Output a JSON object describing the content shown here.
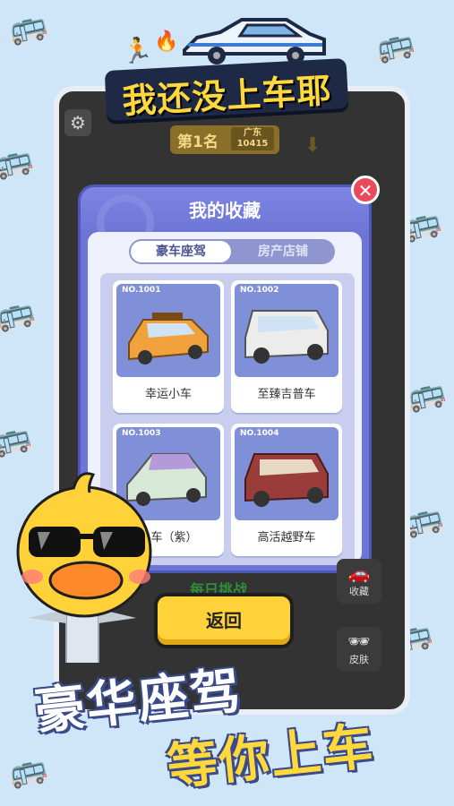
{
  "game": {
    "title": "我还没上车耶"
  },
  "hud": {
    "rank_label": "第1名",
    "rank_region": "广东",
    "rank_score": "10415"
  },
  "modal": {
    "title": "我的收藏",
    "tabs": [
      {
        "label": "豪车座驾",
        "active": true
      },
      {
        "label": "房产店铺",
        "active": false
      }
    ],
    "cards": [
      {
        "no": "NO.1001",
        "name": "幸运小车",
        "color": "#f2a23c"
      },
      {
        "no": "NO.1002",
        "name": "至臻吉普车",
        "color": "#e6e6e6"
      },
      {
        "no": "NO.1003",
        "name": "小车（紫）",
        "color": "#b59ad9"
      },
      {
        "no": "NO.1004",
        "name": "高活越野车",
        "color": "#9a3c3a"
      }
    ]
  },
  "buttons": {
    "daily_challenge": "每日挑战",
    "back": "返回",
    "collection": "收藏",
    "skin": "皮肤"
  },
  "promo": {
    "line1": "豪华座驾",
    "line2": "等你上车"
  },
  "colors": {
    "modal_bg": "#6d76d6",
    "accent_yellow": "#ffd23a",
    "close_red": "#e84a5a"
  }
}
